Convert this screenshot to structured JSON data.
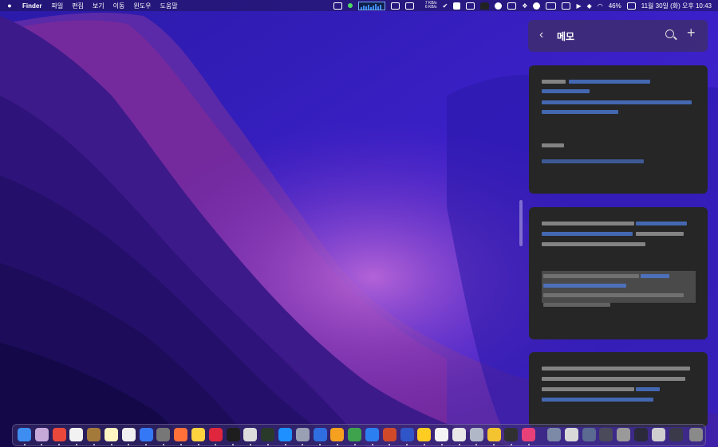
{
  "menubar": {
    "app_name": "Finder",
    "menus": [
      "파일",
      "편집",
      "보기",
      "이동",
      "윈도우",
      "도움말"
    ],
    "net_up": "7 KB/s",
    "net_down": "6 KB/s",
    "battery": "46%",
    "clock": "11월 30일 (화) 오후 10:43"
  },
  "notes_widget": {
    "title": "메모"
  },
  "colors": {
    "note_bg": "#262626",
    "link_blue": "#4f7de0",
    "widget_header": "#3e2d6e"
  },
  "dock": {
    "icons": [
      {
        "name": "finder-icon",
        "color": "#3d8ef0"
      },
      {
        "name": "photos-app-icon",
        "color": "#c7a9d9"
      },
      {
        "name": "calendar-icon",
        "color": "#e9483b"
      },
      {
        "name": "gift-app-icon",
        "color": "#f2f2f2"
      },
      {
        "name": "box-app-icon",
        "color": "#a47a3a"
      },
      {
        "name": "notes-app-icon",
        "color": "#fff5c2"
      },
      {
        "name": "textedit-icon",
        "color": "#f0f0f0"
      },
      {
        "name": "network-icon",
        "color": "#3478f6"
      },
      {
        "name": "pixel-app-icon",
        "color": "#777777"
      },
      {
        "name": "firefox-icon",
        "color": "#ff7139"
      },
      {
        "name": "face-app-icon",
        "color": "#ffd23f"
      },
      {
        "name": "red-app-icon",
        "color": "#e0263c"
      },
      {
        "name": "terminal-icon",
        "color": "#1e1e1e"
      },
      {
        "name": "finder-window-icon",
        "color": "#dcdcdc"
      },
      {
        "name": "activity-monitor-icon",
        "color": "#2a3a2a"
      },
      {
        "name": "preview-icon",
        "color": "#1e90ff"
      },
      {
        "name": "screen-app-icon",
        "color": "#9aa0b4"
      },
      {
        "name": "download-app-icon",
        "color": "#2f6ee0"
      },
      {
        "name": "design-app-icon",
        "color": "#f6a020"
      },
      {
        "name": "chart-app-icon",
        "color": "#3fa34d"
      },
      {
        "name": "blue-app-icon",
        "color": "#2c7ff0"
      },
      {
        "name": "game-app-icon",
        "color": "#d04a2a"
      },
      {
        "name": "tree-app-icon",
        "color": "#3055c8"
      },
      {
        "name": "emoji-app-icon",
        "color": "#ffcc22"
      },
      {
        "name": "typora-icon",
        "color": "#f4f4f4"
      },
      {
        "name": "utility-app-icon",
        "color": "#e8e8e8"
      },
      {
        "name": "photo-app-icon",
        "color": "#b0b8c8"
      },
      {
        "name": "mask-app-icon",
        "color": "#f4c430"
      },
      {
        "name": "monitor-app-icon",
        "color": "#303030"
      },
      {
        "name": "pink-app-icon",
        "color": "#e8417a"
      },
      {
        "name": "window-1-icon",
        "color": "#7c8aa8"
      },
      {
        "name": "window-2-icon",
        "color": "#d8d8d8"
      },
      {
        "name": "window-3-icon",
        "color": "#5a6a90"
      },
      {
        "name": "window-4-icon",
        "color": "#4a4a5a"
      },
      {
        "name": "window-5-icon",
        "color": "#9a9a9a"
      },
      {
        "name": "window-6-icon",
        "color": "#2a2a3a"
      },
      {
        "name": "window-7-icon",
        "color": "#cfcfcf"
      },
      {
        "name": "window-8-icon",
        "color": "#3a3a4a"
      },
      {
        "name": "trash-icon",
        "color": "#8a8a8a"
      }
    ]
  }
}
